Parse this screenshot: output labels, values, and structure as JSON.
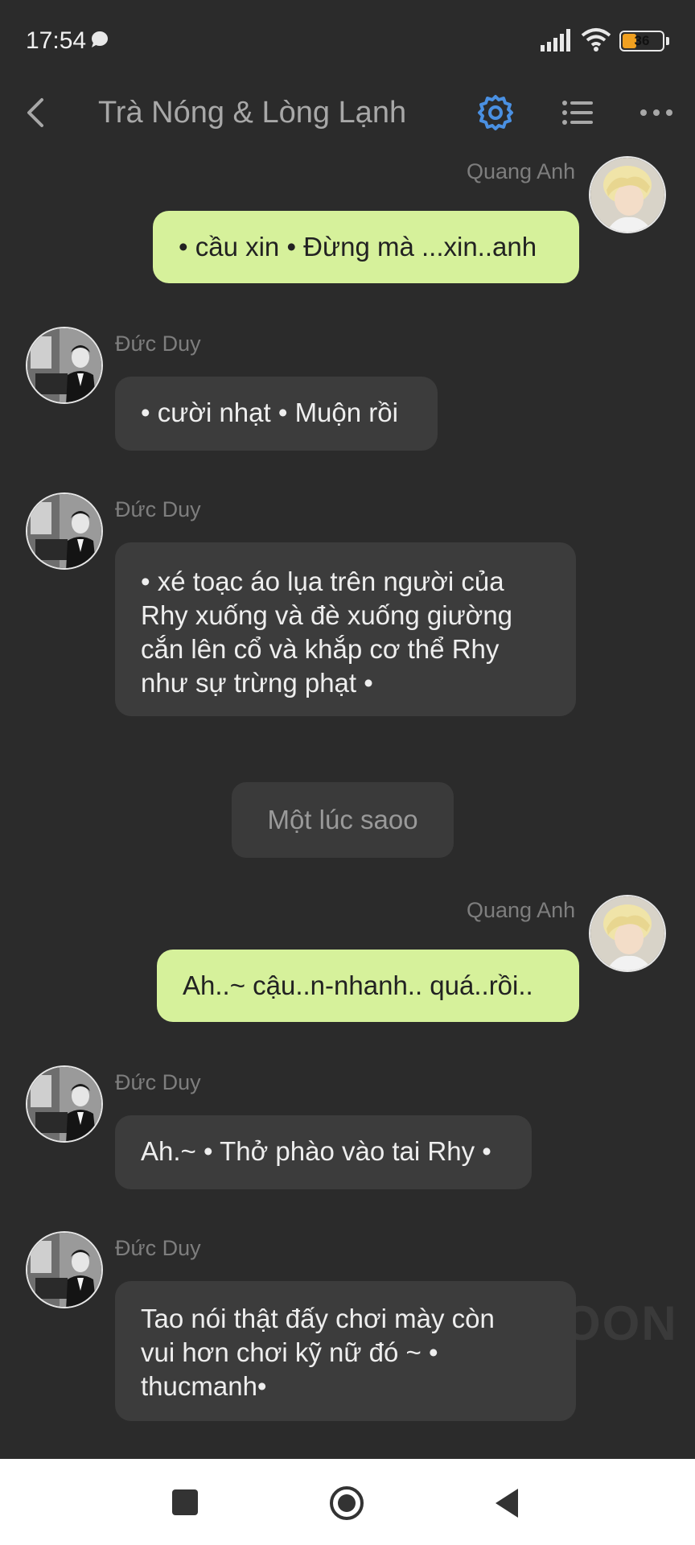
{
  "status_bar": {
    "time": "17:54",
    "battery_level": "36",
    "icons": [
      "chat-bubble-icon",
      "signal-icon",
      "wifi-icon",
      "battery-icon"
    ]
  },
  "header": {
    "title": "Trà Nóng & Lòng Lạnh",
    "accent_color": "#4a90e2",
    "icons": [
      "back-icon",
      "gear-icon",
      "list-icon",
      "more-icon"
    ]
  },
  "messages": [
    {
      "sender": "Quang Anh",
      "side": "right",
      "text": "• cầu xin • Đừng mà ...xin..anh"
    },
    {
      "sender": "Đức Duy",
      "side": "left",
      "text": "• cười nhạt • Muộn rồi"
    },
    {
      "sender": "Đức Duy",
      "side": "left",
      "text": "• xé toạc áo lụa trên người của Rhy xuống và đè xuống giường cắn lên cổ và khắp cơ thể Rhy như sự trừng phạt •"
    },
    {
      "sender": "Quang Anh",
      "side": "right",
      "text": "Ah..~ cậu..n-nhanh.. quá..rồi.."
    },
    {
      "sender": "Đức Duy",
      "side": "left",
      "text": "Ah.~ • Thở phào vào tai Rhy •"
    },
    {
      "sender": "Đức Duy",
      "side": "left",
      "text": "Tao nói thật đấy chơi mày còn vui hơn chơi kỹ nữ đó ~ • thucmanh•"
    }
  ],
  "system_message": "Một lúc saoo",
  "watermark": "OON",
  "colors": {
    "background": "#2b2b2b",
    "outgoing_bubble": "#d6f19b",
    "incoming_bubble": "#3c3c3c"
  }
}
